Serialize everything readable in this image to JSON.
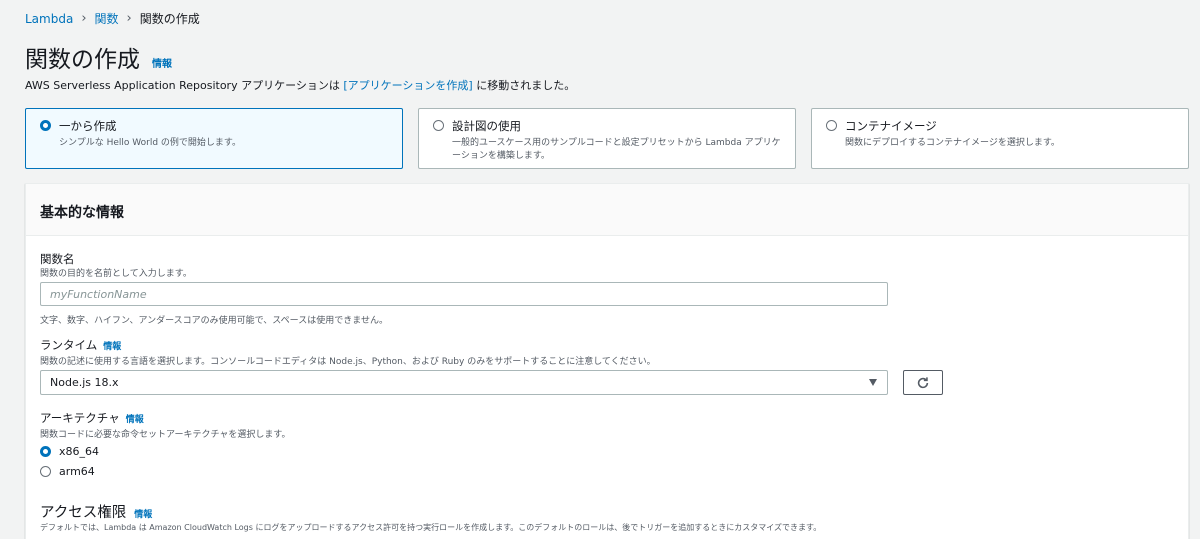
{
  "breadcrumb": {
    "root": "Lambda",
    "parent": "関数",
    "current": "関数の作成"
  },
  "page": {
    "title": "関数の作成",
    "info": "情報",
    "subtitle_prefix": "AWS Serverless Application Repository アプリケーションは ",
    "subtitle_link": "[アプリケーションを作成]",
    "subtitle_suffix": " に移動されました。"
  },
  "options": [
    {
      "title": "一から作成",
      "desc": "シンプルな Hello World の例で開始します。",
      "selected": true
    },
    {
      "title": "設計図の使用",
      "desc": "一般的ユースケース用のサンプルコードと設定プリセットから Lambda アプリケーションを構築します。",
      "selected": false
    },
    {
      "title": "コンテナイメージ",
      "desc": "関数にデプロイするコンテナイメージを選択します。",
      "selected": false
    }
  ],
  "basic": {
    "header": "基本的な情報",
    "function_name_label": "関数名",
    "function_name_desc": "関数の目的を名前として入力します。",
    "function_name_placeholder": "myFunctionName",
    "function_name_hint": "文字、数字、ハイフン、アンダースコアのみ使用可能で、スペースは使用できません。",
    "runtime_label": "ランタイム",
    "runtime_info": "情報",
    "runtime_desc": "関数の記述に使用する言語を選択します。コンソールコードエディタは Node.js、Python、および Ruby のみをサポートすることに注意してください。",
    "runtime_value": "Node.js 18.x",
    "arch_label": "アーキテクチャ",
    "arch_info": "情報",
    "arch_desc": "関数コードに必要な命令セットアーキテクチャを選択します。",
    "arch_options": [
      "x86_64",
      "arm64"
    ],
    "perm_label": "アクセス権限",
    "perm_info": "情報",
    "perm_desc": "デフォルトでは、Lambda は Amazon CloudWatch Logs にログをアップロードするアクセス許可を持つ実行ロールを作成します。このデフォルトのロールは、後でトリガーを追加するときにカスタマイズできます。"
  },
  "colors": {
    "accent": "#0073bb",
    "selected_bg": "#f1faff"
  }
}
